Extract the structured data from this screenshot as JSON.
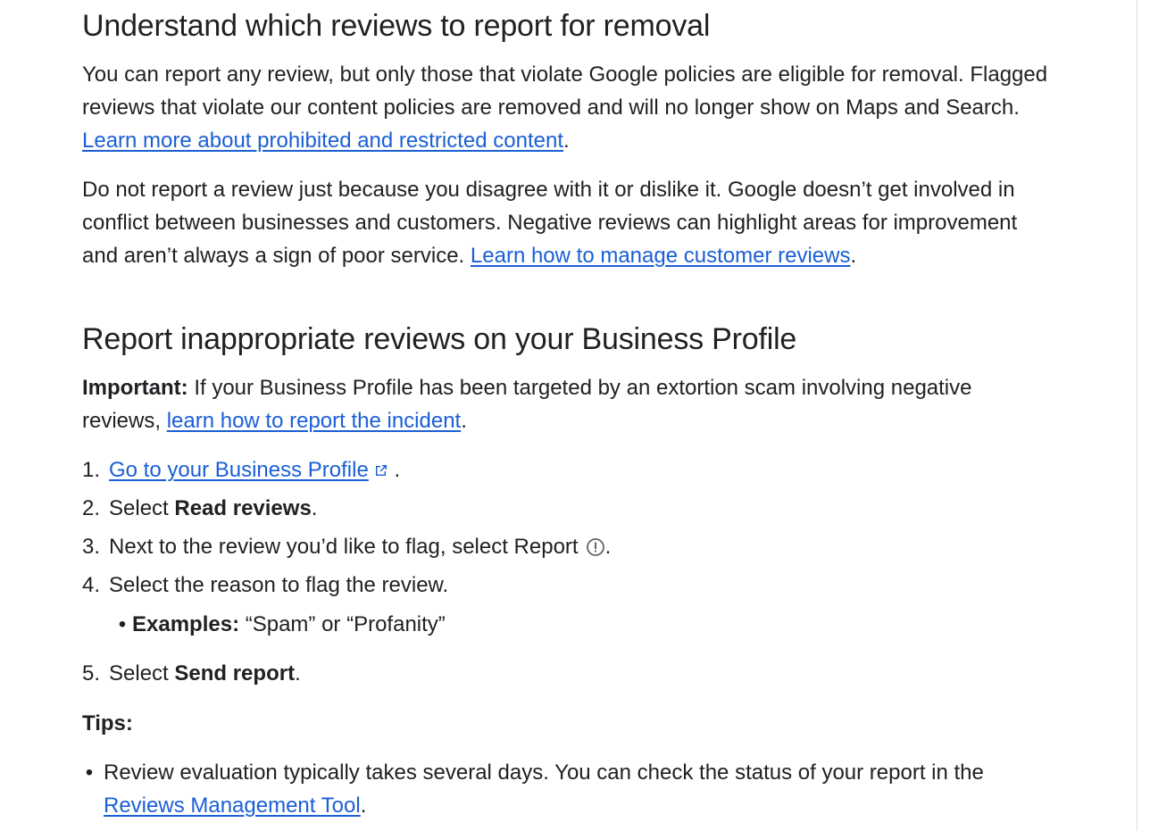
{
  "section1": {
    "heading": "Understand which reviews to report for removal",
    "para1_text": "You can report any review, but only those that violate Google policies are eligible for removal. Flagged reviews that violate our content policies are removed and will no longer show on Maps and Search. ",
    "para1_link": "Learn more about prohibited and restricted content",
    "para2_text": "Do not report a review just because you disagree with it or dislike it. Google doesn’t get involved in conflict between businesses and customers. Negative reviews can highlight areas for improvement and aren’t always a sign of poor service. ",
    "para2_link": "Learn how to manage customer reviews"
  },
  "section2": {
    "heading": "Report inappropriate reviews on your Business Profile",
    "important_label": "Important:",
    "important_text": " If your Business Profile has been targeted by an extortion scam involving negative reviews, ",
    "important_link": "learn how to report the incident",
    "steps": [
      {
        "num": "1.",
        "link": "Go to your Business Profile",
        "icon": "external-link-icon"
      },
      {
        "num": "2.",
        "prefix": "Select ",
        "bold": "Read reviews"
      },
      {
        "num": "3.",
        "prefix": "Next to the review you’d like to flag, select Report",
        "icon": "report-info-icon"
      },
      {
        "num": "4.",
        "prefix": "Select the reason to flag the review."
      },
      {
        "num": "5.",
        "prefix": "Select ",
        "bold": "Send report"
      }
    ],
    "example_label": "Examples:",
    "example_text": " “Spam” or “Profanity”",
    "tips_label": "Tips:",
    "tip1_text": "Review evaluation typically takes several days. You can check the status of your report in the ",
    "tip1_link": "Reviews Management Tool"
  },
  "colors": {
    "link": "#1a5fd6",
    "text": "#202124",
    "icon_gray": "#5f6368"
  }
}
